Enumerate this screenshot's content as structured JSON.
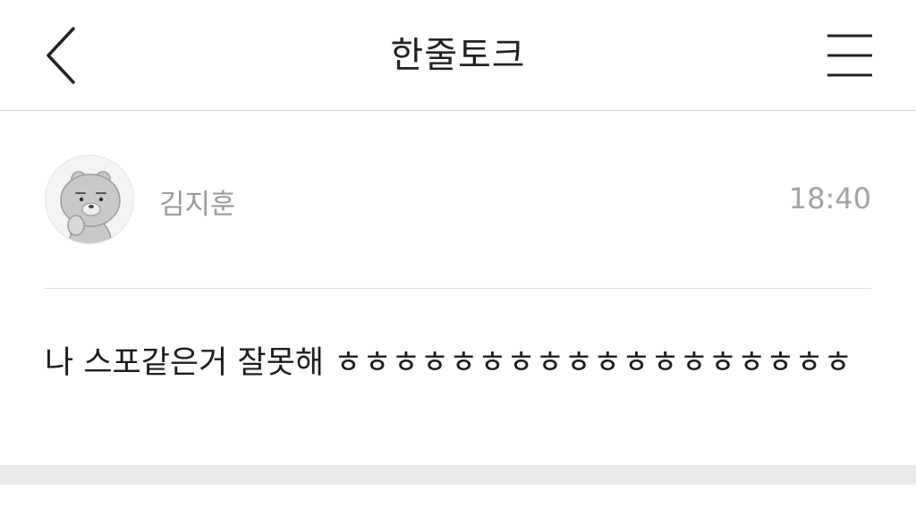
{
  "header": {
    "title": "한줄토크",
    "back_icon": "chevron-left-icon",
    "menu_icon": "hamburger-menu-icon"
  },
  "post": {
    "author": "김지훈",
    "time": "18:40",
    "avatar_icon": "bear-character-avatar",
    "message": "나 스포같은거 잘못해 ㅎㅎㅎㅎㅎㅎㅎㅎㅎㅎㅎㅎㅎㅎㅎㅎㅎㅎ"
  },
  "colors": {
    "background": "#ffffff",
    "text_primary": "#1c1c1c",
    "text_secondary": "#9a9a9a",
    "divider": "#dcdcdc",
    "bottom_band": "#e9e9ec"
  }
}
